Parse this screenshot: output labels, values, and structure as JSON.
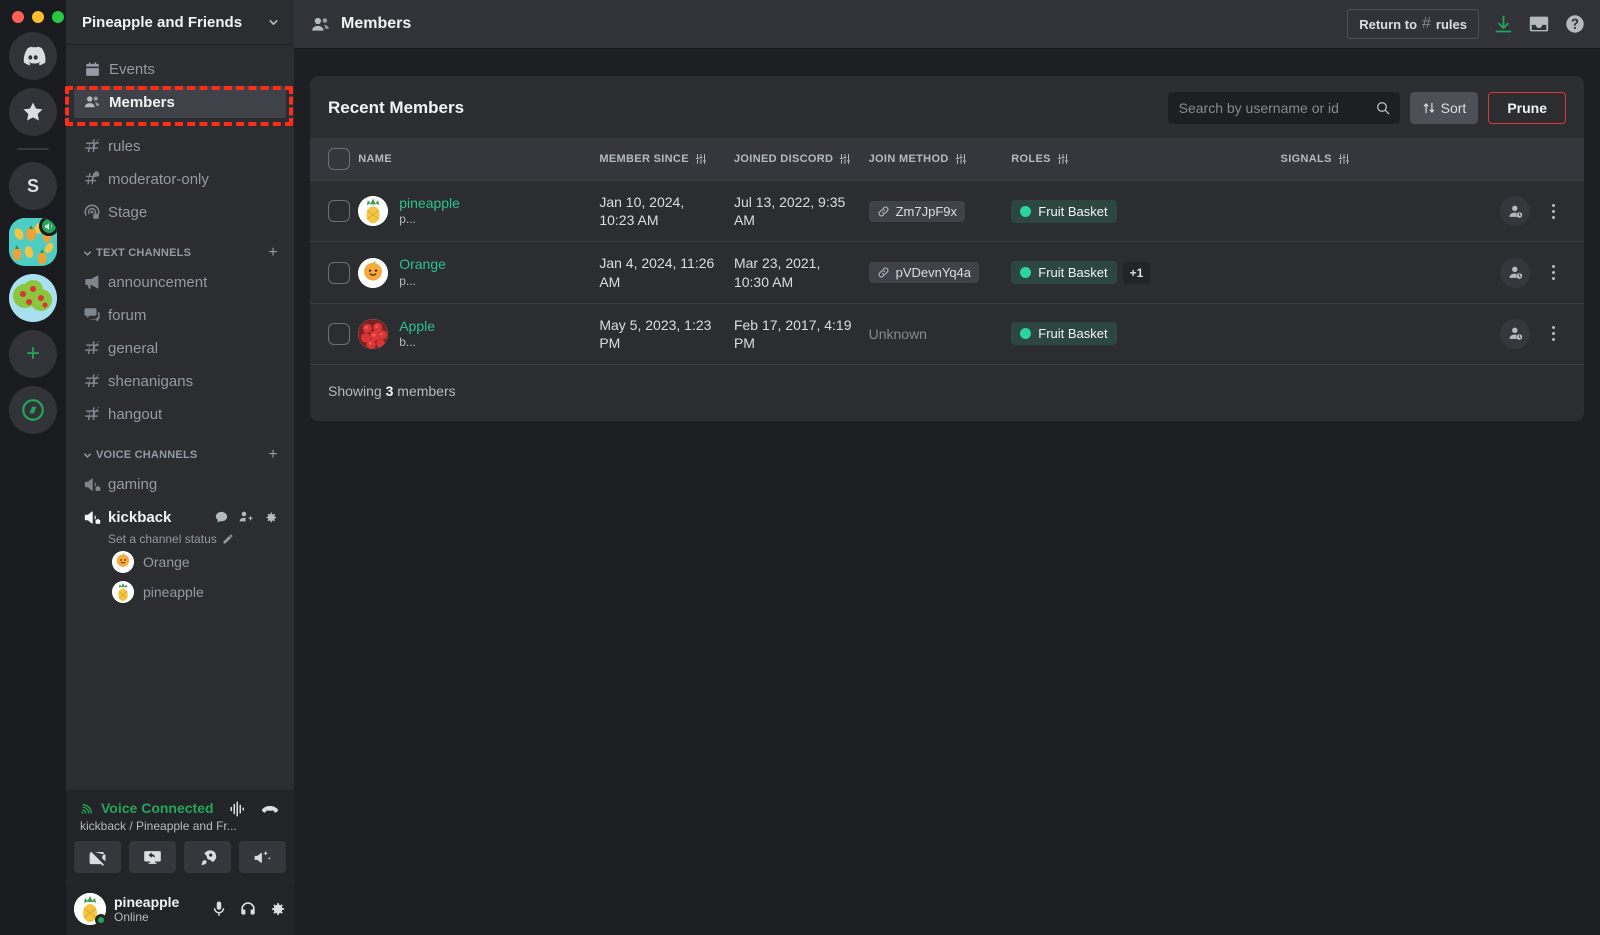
{
  "window": {
    "dots": [
      "close",
      "minimize",
      "maximize"
    ]
  },
  "server_rail": {
    "items": [
      {
        "name": "discord-home",
        "type": "logo"
      },
      {
        "name": "favorites",
        "type": "star"
      },
      {
        "name": "server-s",
        "type": "letter",
        "letter": "S"
      },
      {
        "name": "server-pineapple-and-friends",
        "type": "image",
        "active": true,
        "voice_badge": true
      },
      {
        "name": "server-apple",
        "type": "image",
        "active": false
      },
      {
        "name": "add-server",
        "type": "plus"
      },
      {
        "name": "explore-servers",
        "type": "compass"
      }
    ]
  },
  "sidebar": {
    "server_name": "Pineapple and Friends",
    "nav": [
      {
        "label": "Events",
        "icon": "calendar-icon",
        "active": false
      },
      {
        "label": "Members",
        "icon": "members-icon",
        "active": true
      }
    ],
    "top_channels": [
      {
        "label": "rules",
        "icon": "hash-icon"
      },
      {
        "label": "moderator-only",
        "icon": "hash-lock-icon"
      },
      {
        "label": "Stage",
        "icon": "stage-lock-icon"
      }
    ],
    "text_category": {
      "label": "TEXT CHANNELS",
      "add": "+"
    },
    "text_channels": [
      {
        "label": "announcement",
        "icon": "announcement-icon"
      },
      {
        "label": "forum",
        "icon": "forum-icon"
      },
      {
        "label": "general",
        "icon": "hash-icon"
      },
      {
        "label": "shenanigans",
        "icon": "hash-icon"
      },
      {
        "label": "hangout",
        "icon": "hash-icon"
      }
    ],
    "voice_category": {
      "label": "VOICE CHANNELS",
      "add": "+"
    },
    "voice_channels": [
      {
        "label": "gaming",
        "icon": "voice-lock-icon",
        "selected": false
      },
      {
        "label": "kickback",
        "icon": "voice-lock-icon",
        "selected": true,
        "status_placeholder": "Set a channel status",
        "members": [
          {
            "name": "Orange"
          },
          {
            "name": "pineapple"
          }
        ]
      }
    ]
  },
  "voice_panel": {
    "status": "Voice Connected",
    "location": "kickback / Pineapple and Fr...",
    "buttons": [
      {
        "name": "camera-off-button"
      },
      {
        "name": "screen-share-button"
      },
      {
        "name": "activity-rocket-button"
      },
      {
        "name": "soundboard-button"
      }
    ],
    "icons": [
      {
        "name": "signal-icon"
      },
      {
        "name": "disconnect-icon"
      }
    ]
  },
  "user_panel": {
    "username": "pineapple",
    "status": "Online",
    "icons": [
      {
        "name": "microphone-icon"
      },
      {
        "name": "headphones-icon"
      },
      {
        "name": "settings-gear-icon"
      }
    ]
  },
  "topbar": {
    "title": "Members",
    "return_label": "Return to",
    "return_channel": "rules",
    "icons": [
      {
        "name": "download-icon",
        "color": "#23a55a"
      },
      {
        "name": "inbox-icon"
      },
      {
        "name": "help-icon"
      }
    ]
  },
  "members_panel": {
    "title": "Recent Members",
    "search": {
      "placeholder": "Search by username or id",
      "value": ""
    },
    "sort_label": "Sort",
    "prune_label": "Prune",
    "prune_color": "#da373c",
    "columns": [
      {
        "key": "name",
        "label": "NAME",
        "filter": false
      },
      {
        "key": "member_since",
        "label": "MEMBER SINCE",
        "filter": true
      },
      {
        "key": "joined_discord",
        "label": "JOINED DISCORD",
        "filter": true
      },
      {
        "key": "join_method",
        "label": "JOIN METHOD",
        "filter": true
      },
      {
        "key": "roles",
        "label": "ROLES",
        "filter": true
      },
      {
        "key": "signals",
        "label": "SIGNALS",
        "filter": true
      }
    ],
    "rows": [
      {
        "name": "pineapple",
        "subname": "p...",
        "avatar": "pineapple",
        "member_since": "Jan 10, 2024, 10:23 AM",
        "joined_discord": "Jul 13, 2022, 9:35 AM",
        "join_method": "Zm7JpF9x",
        "join_method_type": "invite",
        "roles": [
          {
            "label": "Fruit Basket",
            "color": "#2dd4a0"
          }
        ],
        "extra_roles": ""
      },
      {
        "name": "Orange",
        "subname": "p...",
        "avatar": "orange",
        "member_since": "Jan 4, 2024, 11:26 AM",
        "joined_discord": "Mar 23, 2021, 10:30 AM",
        "join_method": "pVDevnYq4a",
        "join_method_type": "invite",
        "roles": [
          {
            "label": "Fruit Basket",
            "color": "#2dd4a0"
          }
        ],
        "extra_roles": "+1"
      },
      {
        "name": "Apple",
        "subname": "b...",
        "avatar": "apple",
        "member_since": "May 5, 2023, 1:23 PM",
        "joined_discord": "Feb 17, 2017, 4:19 PM",
        "join_method": "Unknown",
        "join_method_type": "unknown",
        "roles": [
          {
            "label": "Fruit Basket",
            "color": "#2dd4a0"
          }
        ],
        "extra_roles": ""
      }
    ],
    "footer_prefix": "Showing ",
    "footer_count": "3",
    "footer_suffix": " members"
  },
  "annotation": {
    "color": "#ff2d16",
    "target": "Members"
  }
}
